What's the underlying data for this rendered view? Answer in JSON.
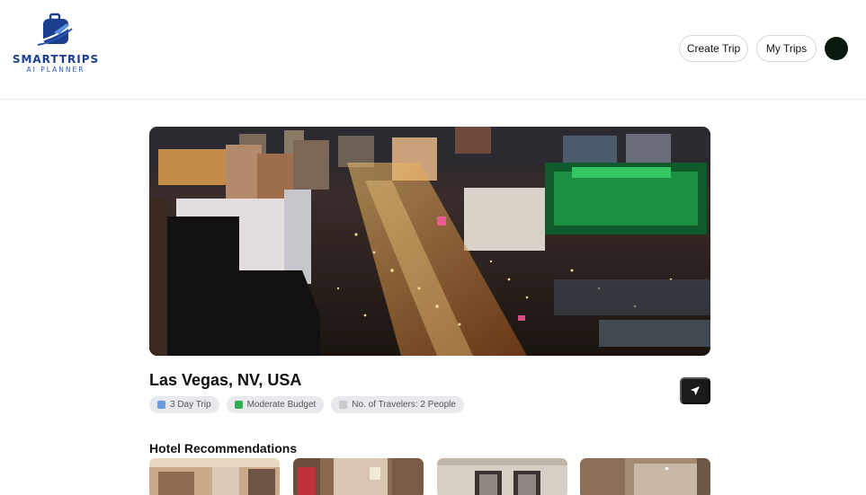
{
  "brand": {
    "title": "SMARTTRIPS",
    "subtitle": "AI PLANNER",
    "logo_icon": "suitcase-plane-icon",
    "color_primary": "#1b3e8f",
    "color_secondary": "#2a57b5"
  },
  "nav": {
    "create_trip": "Create Trip",
    "my_trips": "My Trips",
    "avatar_color": "#0b1a0f"
  },
  "trip": {
    "location": "Las Vegas, NV, USA",
    "hero_alt": "aerial-night-cityscape",
    "chips": [
      {
        "icon": "calendar-icon",
        "label": "3 Day Trip"
      },
      {
        "icon": "money-icon",
        "label": "Moderate Budget"
      },
      {
        "icon": "travelers-icon",
        "label": "No. of Travelers: 2 People"
      }
    ],
    "share_icon": "send-icon"
  },
  "hotels": {
    "title": "Hotel Recommendations"
  }
}
